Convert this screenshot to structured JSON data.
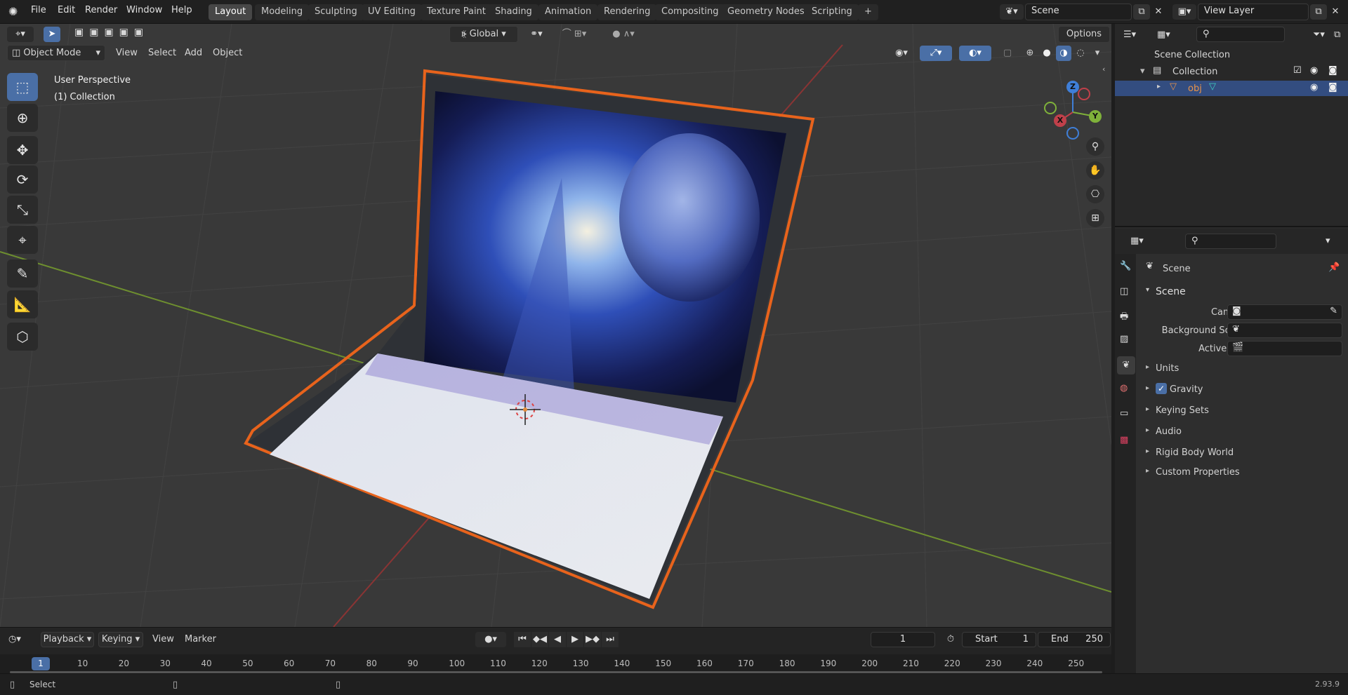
{
  "menu": {
    "items": [
      "File",
      "Edit",
      "Render",
      "Window",
      "Help"
    ]
  },
  "workspaces": {
    "tabs": [
      "Layout",
      "Modeling",
      "Sculpting",
      "UV Editing",
      "Texture Paint",
      "Shading",
      "Animation",
      "Rendering",
      "Compositing",
      "Geometry Nodes",
      "Scripting"
    ],
    "active": "Layout",
    "add": "+"
  },
  "scene_field": "Scene",
  "view_layer_field": "View Layer",
  "viewport": {
    "mode": "Object Mode",
    "menus": [
      "View",
      "Select",
      "Add",
      "Object"
    ],
    "transform_orientation": "Global",
    "options_label": "Options",
    "overlay_line1": "User Perspective",
    "overlay_line2": "(1) Collection",
    "gizmo": {
      "z": "Z",
      "y": "Y",
      "x": "X"
    }
  },
  "outliner": {
    "root": "Scene Collection",
    "collection": "Collection",
    "object": "obj"
  },
  "properties": {
    "context_title": "Scene",
    "panel_title": "Scene",
    "camera_label": "Camera",
    "background_scene_label": "Background Scene",
    "active_clip_label": "Active Clip",
    "sections": [
      "Units",
      "Gravity",
      "Keying Sets",
      "Audio",
      "Rigid Body World",
      "Custom Properties"
    ],
    "gravity_checked": true
  },
  "timeline": {
    "menus": [
      "Playback",
      "Keying",
      "View",
      "Marker"
    ],
    "current_frame": "1",
    "start_label": "Start",
    "start_value": "1",
    "end_label": "End",
    "end_value": "250",
    "ticks": [
      "1",
      "10",
      "20",
      "30",
      "40",
      "50",
      "60",
      "70",
      "80",
      "90",
      "100",
      "110",
      "120",
      "130",
      "140",
      "150",
      "160",
      "170",
      "180",
      "190",
      "200",
      "210",
      "220",
      "230",
      "240",
      "250"
    ]
  },
  "status": {
    "select": "Select",
    "version": "2.93.9"
  },
  "colors": {
    "accent": "#4a6fa6",
    "selection_outline": "#e8631c",
    "x_axis": "#c0404a",
    "y_axis": "#7fb13a",
    "z_axis": "#3f7fd8"
  }
}
